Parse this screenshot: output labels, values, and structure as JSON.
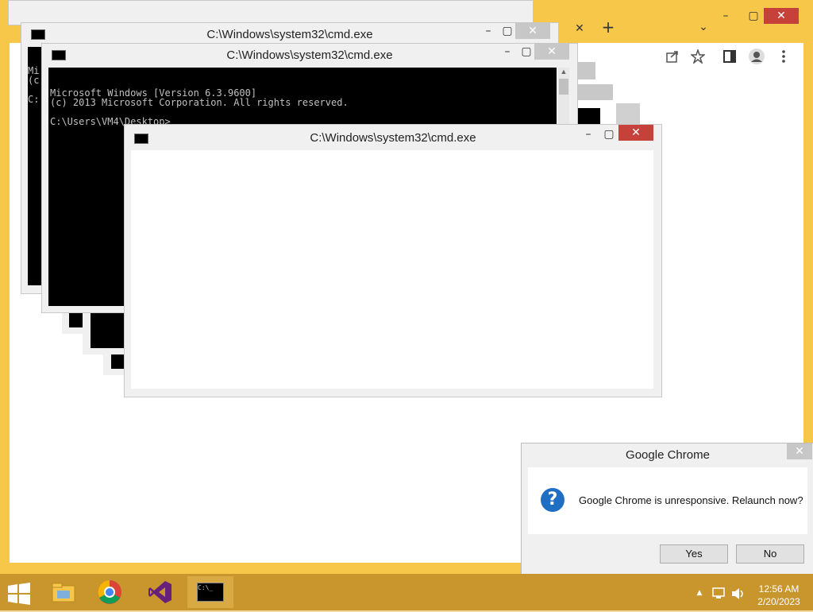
{
  "chrome": {
    "caption_buttons": {
      "minimize": "–",
      "maximize": "▢",
      "close": "✕"
    },
    "tab_close": "✕",
    "new_tab": "+",
    "tab_search": "⌄",
    "toolbar_icons": [
      "share-icon",
      "star-icon",
      "sidepanel-icon",
      "profile-icon",
      "menu-icon"
    ]
  },
  "cmd_windows": [
    {
      "title": "C:\\Windows\\system32\\cmd.exe",
      "lines": [
        "Mi",
        "(c",
        "",
        "C:"
      ]
    },
    {
      "title": "C:\\Windows\\system32\\cmd.exe",
      "lines": [
        "Microsoft Windows [Version 6.3.9600]",
        "(c) 2013 Microsoft Corporation. All rights reserved.",
        "",
        "C:\\Users\\VM4\\Desktop>"
      ]
    },
    {
      "title": "C:\\Windows\\system32\\cmd.exe",
      "lines": []
    }
  ],
  "cmd_icon_text": "C:\\_",
  "dialog": {
    "title": "Google Chrome",
    "message": "Google Chrome is unresponsive. Relaunch now?",
    "icon": "?",
    "yes": "Yes",
    "no": "No",
    "close": "✕"
  },
  "taskbar": {
    "start_icon": "windows-logo-icon",
    "items": [
      "file-explorer",
      "google-chrome",
      "visual-studio",
      "command-prompt"
    ],
    "time": "12:56 AM",
    "date": "2/20/2023",
    "tray_chevron": "▲"
  }
}
